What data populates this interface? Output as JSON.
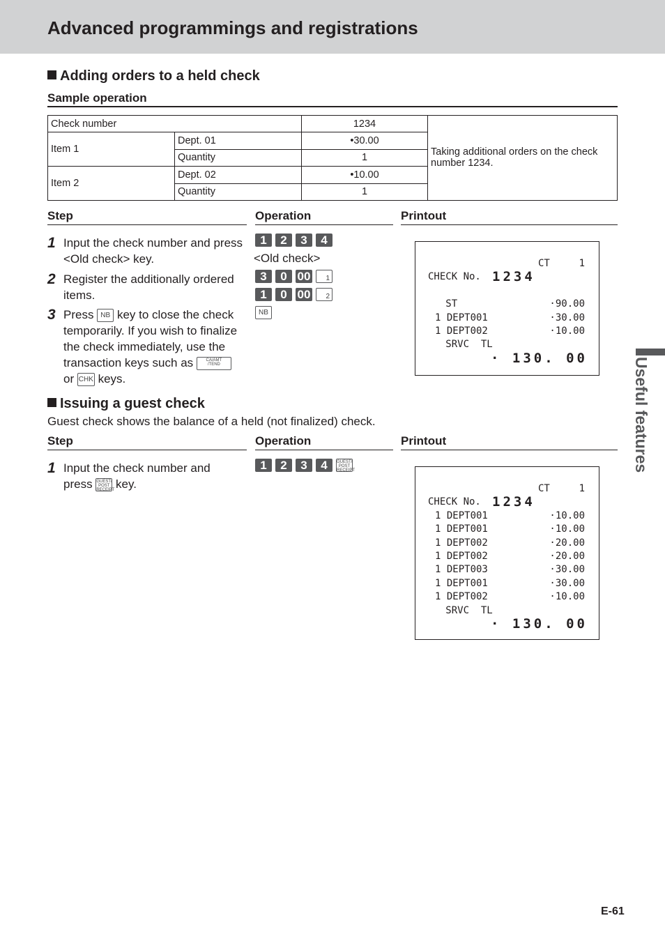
{
  "header": {
    "title": "Advanced programmings and registrations"
  },
  "section1": {
    "title": "Adding orders to a held check",
    "sample_label": "Sample operation",
    "table": {
      "check_number_label": "Check number",
      "check_number": "1234",
      "items": [
        {
          "label": "Item 1",
          "dept_label": "Dept. 01",
          "price": "•30.00",
          "qty_label": "Quantity",
          "qty": "1"
        },
        {
          "label": "Item 2",
          "dept_label": "Dept. 02",
          "price": "•10.00",
          "qty_label": "Quantity",
          "qty": "1"
        }
      ],
      "note": "Taking additional orders on the check number 1234."
    },
    "columns": {
      "step": "Step",
      "operation": "Operation",
      "printout": "Printout"
    },
    "steps": [
      {
        "num": "1",
        "text": "Input the check number and press <Old check> key."
      },
      {
        "num": "2",
        "text": "Register the additionally ordered items."
      },
      {
        "num": "3",
        "pre": "Press",
        "post": "key to close the check temporarily. If you wish to finalize the check immediately, use the transaction keys such as",
        "or": "or",
        "end": "keys."
      }
    ],
    "operation": {
      "keys1": [
        "1",
        "2",
        "3",
        "4"
      ],
      "old_check": "<Old check>",
      "keys2": [
        "3",
        "0",
        "00"
      ],
      "dept_key2": "1",
      "keys3": [
        "1",
        "0",
        "00"
      ],
      "dept_key3": "2",
      "nb_key": "NB",
      "ca_key_top": "CA/AMT",
      "ca_key_bottom": "/TEND",
      "chk_key": "CHK"
    },
    "printout": {
      "ct_label": "CT",
      "ct_value": "1",
      "check_label": "CHECK No.",
      "check_no": "1234",
      "lines": [
        {
          "left": "   ST",
          "right": "·90.00"
        },
        {
          "left": "1 DEPT001",
          "right": "·30.00"
        },
        {
          "left": "1 DEPT002",
          "right": "·10.00"
        },
        {
          "left": "   SRVC  TL",
          "right": ""
        }
      ],
      "total": "· 130. 00"
    }
  },
  "section2": {
    "title": "Issuing a guest check",
    "description": "Guest check shows the balance of a held (not finalized) check.",
    "columns": {
      "step": "Step",
      "operation": "Operation",
      "printout": "Printout"
    },
    "steps": [
      {
        "num": "1",
        "pre": "Input the check number and",
        "press": "press",
        "post": "key."
      }
    ],
    "operation": {
      "keys": [
        "1",
        "2",
        "3",
        "4"
      ],
      "guest_key": [
        "GUEST/",
        "POST",
        "RECEIPT"
      ]
    },
    "printout": {
      "ct_label": "CT",
      "ct_value": "1",
      "check_label": "CHECK No.",
      "check_no": "1234",
      "lines": [
        {
          "left": "1 DEPT001",
          "right": "·10.00"
        },
        {
          "left": "1 DEPT001",
          "right": "·10.00"
        },
        {
          "left": "1 DEPT002",
          "right": "·20.00"
        },
        {
          "left": "1 DEPT002",
          "right": "·20.00"
        },
        {
          "left": "1 DEPT003",
          "right": "·30.00"
        },
        {
          "left": "1 DEPT001",
          "right": "·30.00"
        },
        {
          "left": "1 DEPT002",
          "right": "·10.00"
        },
        {
          "left": "   SRVC  TL",
          "right": ""
        }
      ],
      "total": "· 130. 00"
    }
  },
  "side_tab": "Useful features",
  "page_number": "E-61"
}
